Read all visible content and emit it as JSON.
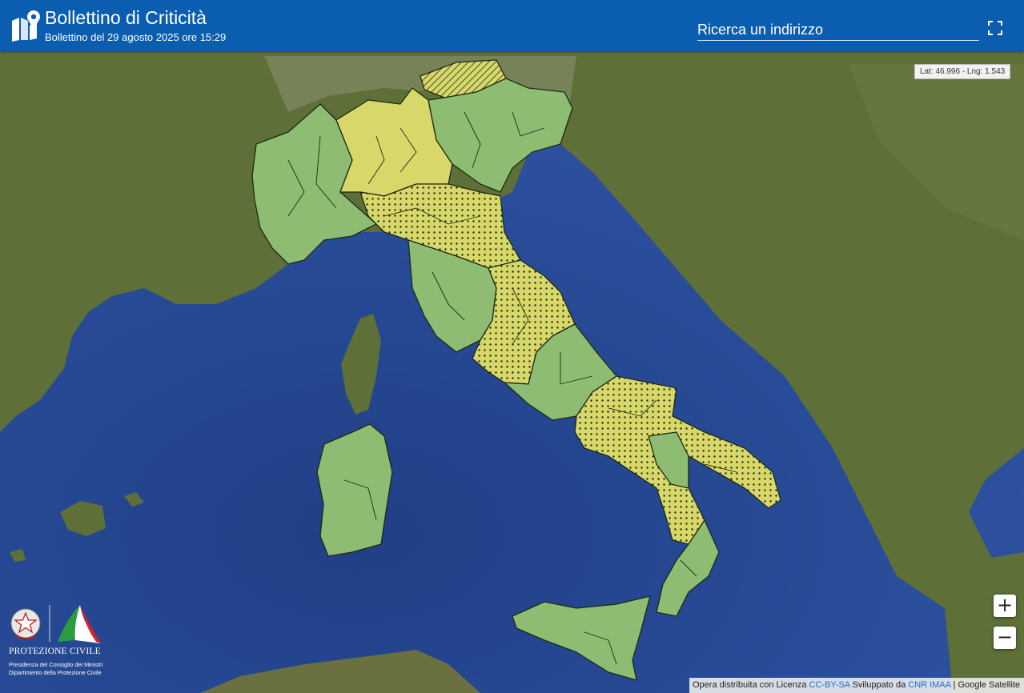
{
  "header": {
    "title": "Bollettino di Criticità",
    "subtitle": "Bollettino del 29 agosto 2025 ore 15:29",
    "logo_icon": "map-pin-icon",
    "search_placeholder": "Ricerca un indirizzo",
    "fullscreen_icon": "fullscreen-icon"
  },
  "map": {
    "coords_readout": "Lat: 46.996 - Lng: 1.543",
    "zoom_in_label": "+",
    "zoom_out_label": "−",
    "colors": {
      "sea": "#2b4d97",
      "land": "#5e6f38",
      "green_zone": "#8dbc72",
      "yellow_zone": "#d8d86a",
      "border": "#1e2a14"
    },
    "legend_meaning": [
      "green",
      "yellow",
      "yellow-dotted",
      "yellow-hatched"
    ]
  },
  "attribution": {
    "prefix": "Opera distribuita con Licenza",
    "license": "CC-BY-SA",
    "developed": "Sviluppato da",
    "developer": "CNR IMAA",
    "sep": "|",
    "basemap": "Google Satellite"
  },
  "footer_logo": {
    "name": "PROTEZIONE CIVILE",
    "line1": "Presidenza del Consiglio dei Ministri",
    "line2": "Dipartimento della Protezione Civile"
  }
}
